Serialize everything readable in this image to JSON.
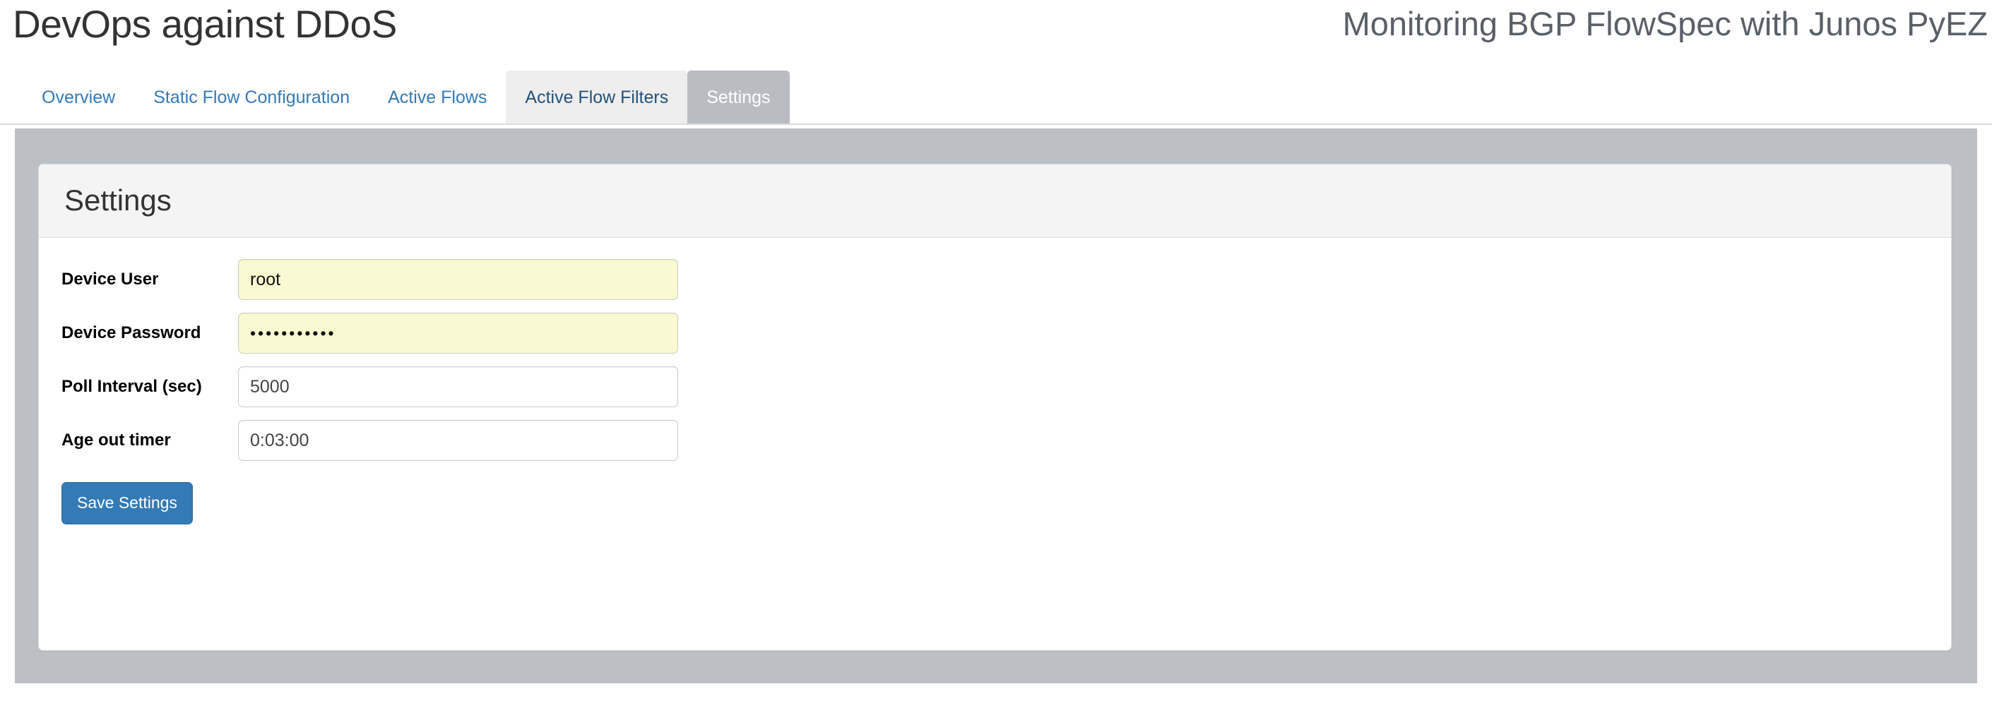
{
  "header": {
    "brand_title": "DevOps against DDoS",
    "page_subtitle": "Monitoring BGP FlowSpec with Junos PyEZ"
  },
  "tabs": [
    {
      "label": "Overview",
      "state": "normal"
    },
    {
      "label": "Static Flow Configuration",
      "state": "normal"
    },
    {
      "label": "Active Flows",
      "state": "normal"
    },
    {
      "label": "Active Flow Filters",
      "state": "hovered"
    },
    {
      "label": "Settings",
      "state": "active"
    }
  ],
  "panel": {
    "title": "Settings",
    "fields": [
      {
        "label": "Device User",
        "value": "root",
        "placeholder": "",
        "type": "text",
        "autofilled": true,
        "name": "device-user"
      },
      {
        "label": "Device Password",
        "value": "•••••••••••",
        "placeholder": "",
        "type": "password",
        "autofilled": true,
        "name": "device-password"
      },
      {
        "label": "Poll Interval (sec)",
        "value": "5000",
        "placeholder": "",
        "type": "text",
        "autofilled": false,
        "name": "poll-interval"
      },
      {
        "label": "Age out timer",
        "value": "0:03:00",
        "placeholder": "",
        "type": "text",
        "autofilled": false,
        "name": "age-out-timer"
      }
    ],
    "save_button_label": "Save Settings"
  },
  "colors": {
    "link": "#337ab7",
    "active_tab_bg": "#b9bcc2",
    "hover_tab_bg": "#eeeeee",
    "page_container_bg": "#bcbfc4",
    "panel_heading_bg": "#f4f4f4",
    "autofill_bg": "#fafad2",
    "button_primary": "#337ab7",
    "subtitle_text": "#5a6069",
    "title_text": "#333333"
  }
}
